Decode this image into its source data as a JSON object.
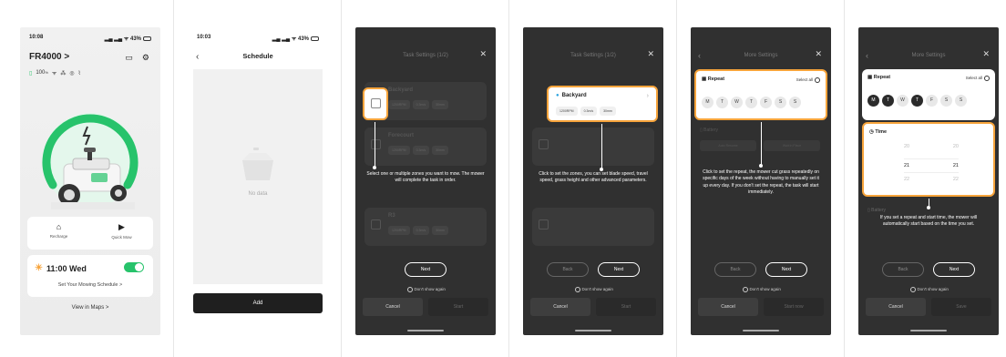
{
  "screen1": {
    "time": "10:08",
    "status_right": "43%",
    "title": "FR4000 >",
    "battery_stat": "100",
    "battery_unit": "%",
    "recharge_label": "Recharge",
    "quick_mow_label": "Quick Mow",
    "schedule_time": "11:00 Wed",
    "schedule_link": "Set Your Mowing Schedule >",
    "maps_link": "View in Maps >",
    "colors": {
      "accent": "#27c36b",
      "sun": "#f7a43b"
    }
  },
  "screen2": {
    "time": "10:03",
    "status_right": "43%",
    "title": "Schedule",
    "empty_text": "No data",
    "add_label": "Add"
  },
  "screen3": {
    "header": "Task Settings (1/2)",
    "zones": [
      "Backyard",
      "Forecourt",
      "R3"
    ],
    "chip_rpm": "1200RPM",
    "chip_speed": "0.3m/s",
    "chip_height": "30mm",
    "tip": "Select one or multiple zones you want to mow. The mower will complete the task in order.",
    "next_label": "Next",
    "dont_show": "Don't show again",
    "cancel_label": "Cancel",
    "start_label": "Start"
  },
  "screen4": {
    "header": "Task Settings (1/2)",
    "zone_name": "Backyard",
    "chip_rpm": "1200RPM",
    "chip_speed": "0.3m/s",
    "chip_height": "30mm",
    "tip": "Click to set the zones, you can set blade speed, travel speed, grass height and other advanced parameters.",
    "back_label": "Back",
    "next_label": "Next",
    "dont_show": "Don't show again",
    "cancel_label": "Cancel",
    "start_label": "Start"
  },
  "screen5": {
    "header": "More Settings",
    "repeat_label": "Repeat",
    "select_all": "Select all",
    "days": [
      "M",
      "T",
      "W",
      "T",
      "F",
      "S",
      "S"
    ],
    "battery_label": "Battery",
    "battery_opt1": "Auto Resume",
    "battery_opt2": "Wait in Place",
    "tip": "Click to set the repeat, the mower cut grass repeatedly on specific days of the week without having to manually set it up every day. If you don't set the repeat, the task will start immediately.",
    "back_label": "Back",
    "next_label": "Next",
    "dont_show": "Don't show again",
    "cancel_label": "Cancel",
    "start_label": "Start now"
  },
  "screen6": {
    "header": "More Settings",
    "repeat_label": "Repeat",
    "select_all": "Select all",
    "days": [
      "M",
      "T",
      "W",
      "T",
      "F",
      "S",
      "S"
    ],
    "days_on": [
      true,
      true,
      false,
      true,
      false,
      false,
      false
    ],
    "time_label": "Time",
    "time_rows": [
      [
        "20",
        "20"
      ],
      [
        "21",
        "21"
      ],
      [
        "22",
        "22"
      ]
    ],
    "battery_label": "Battery",
    "tip": "If you set a repeat and start time, the mower will automatically start based on the time you set.",
    "back_label": "Back",
    "next_label": "Next",
    "dont_show": "Don't show again",
    "cancel_label": "Cancel",
    "save_label": "Save"
  }
}
